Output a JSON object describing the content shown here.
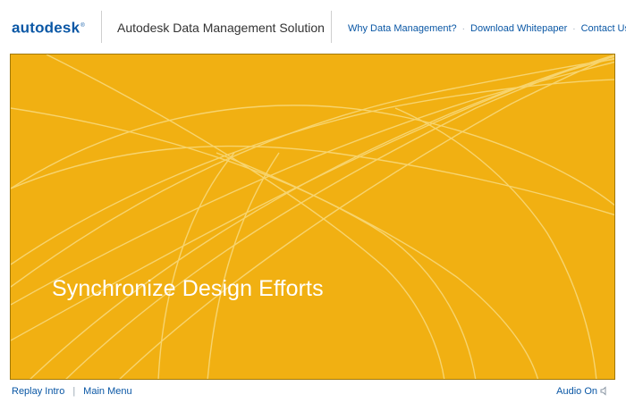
{
  "header": {
    "logo_text": "autodesk",
    "logo_mark": "®",
    "app_title": "Autodesk Data Management Solution",
    "nav": [
      {
        "label": "Why Data Management?"
      },
      {
        "label": "Download Whitepaper"
      },
      {
        "label": "Contact Us"
      }
    ],
    "nav_separator": "·"
  },
  "stage": {
    "heading": "Synchronize Design Efforts",
    "background_color": "#f1b012",
    "line_color": "#f8d879"
  },
  "footer": {
    "replay_label": "Replay Intro",
    "separator": "|",
    "main_menu_label": "Main Menu",
    "audio_label": "Audio On",
    "audio_icon": "speaker-icon"
  },
  "colors": {
    "brand_blue": "#0a57a5",
    "title_gray": "#333333"
  }
}
